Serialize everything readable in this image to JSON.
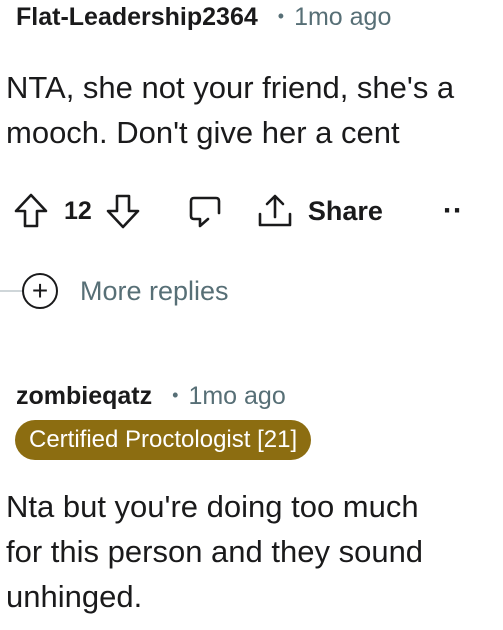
{
  "comment1": {
    "username": "Flat-Leadership2364",
    "separator": "•",
    "time": "1mo ago",
    "body_lines": [
      "NTA, she not your friend, she's a",
      "mooch. Don't give her a cent"
    ],
    "score": "12",
    "share_label": "Share",
    "more_label": "··"
  },
  "more_replies": {
    "plus": "+",
    "label": "More replies"
  },
  "comment2": {
    "username": "zombieqatz",
    "separator": "•",
    "time": "1mo ago",
    "flair": "Certified Proctologist [21]",
    "body_lines": [
      "Nta but you're doing too much",
      "for this person and they sound",
      "unhinged."
    ]
  },
  "colors": {
    "text": "#1a1a1b",
    "muted": "#576f76",
    "flair_bg": "#8c6d11",
    "flair_text": "#ffffff"
  },
  "icons": [
    "upvote-icon",
    "downvote-icon",
    "comment-icon",
    "share-icon",
    "plus-circle-icon"
  ]
}
